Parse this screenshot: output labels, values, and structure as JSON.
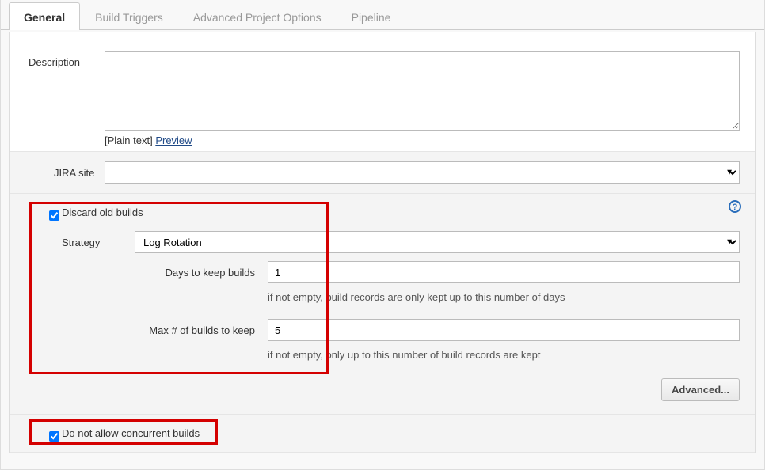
{
  "tabs": {
    "items": [
      "General",
      "Build Triggers",
      "Advanced Project Options",
      "Pipeline"
    ],
    "activeIndex": 0
  },
  "description": {
    "label": "Description",
    "value": "",
    "plain_text_label": "[Plain text] ",
    "preview_link": "Preview"
  },
  "jira": {
    "label": "JIRA site",
    "value": ""
  },
  "discard": {
    "checked": true,
    "label": "Discard old builds",
    "strategy_label": "Strategy",
    "strategy_value": "Log Rotation",
    "days_label": "Days to keep builds",
    "days_value": "1",
    "days_hint": "if not empty, build records are only kept up to this number of days",
    "max_label": "Max # of builds to keep",
    "max_value": "5",
    "max_hint": "if not empty, only up to this number of build records are kept",
    "advanced_button": "Advanced..."
  },
  "concurrent": {
    "checked": true,
    "label": "Do not allow concurrent builds"
  }
}
